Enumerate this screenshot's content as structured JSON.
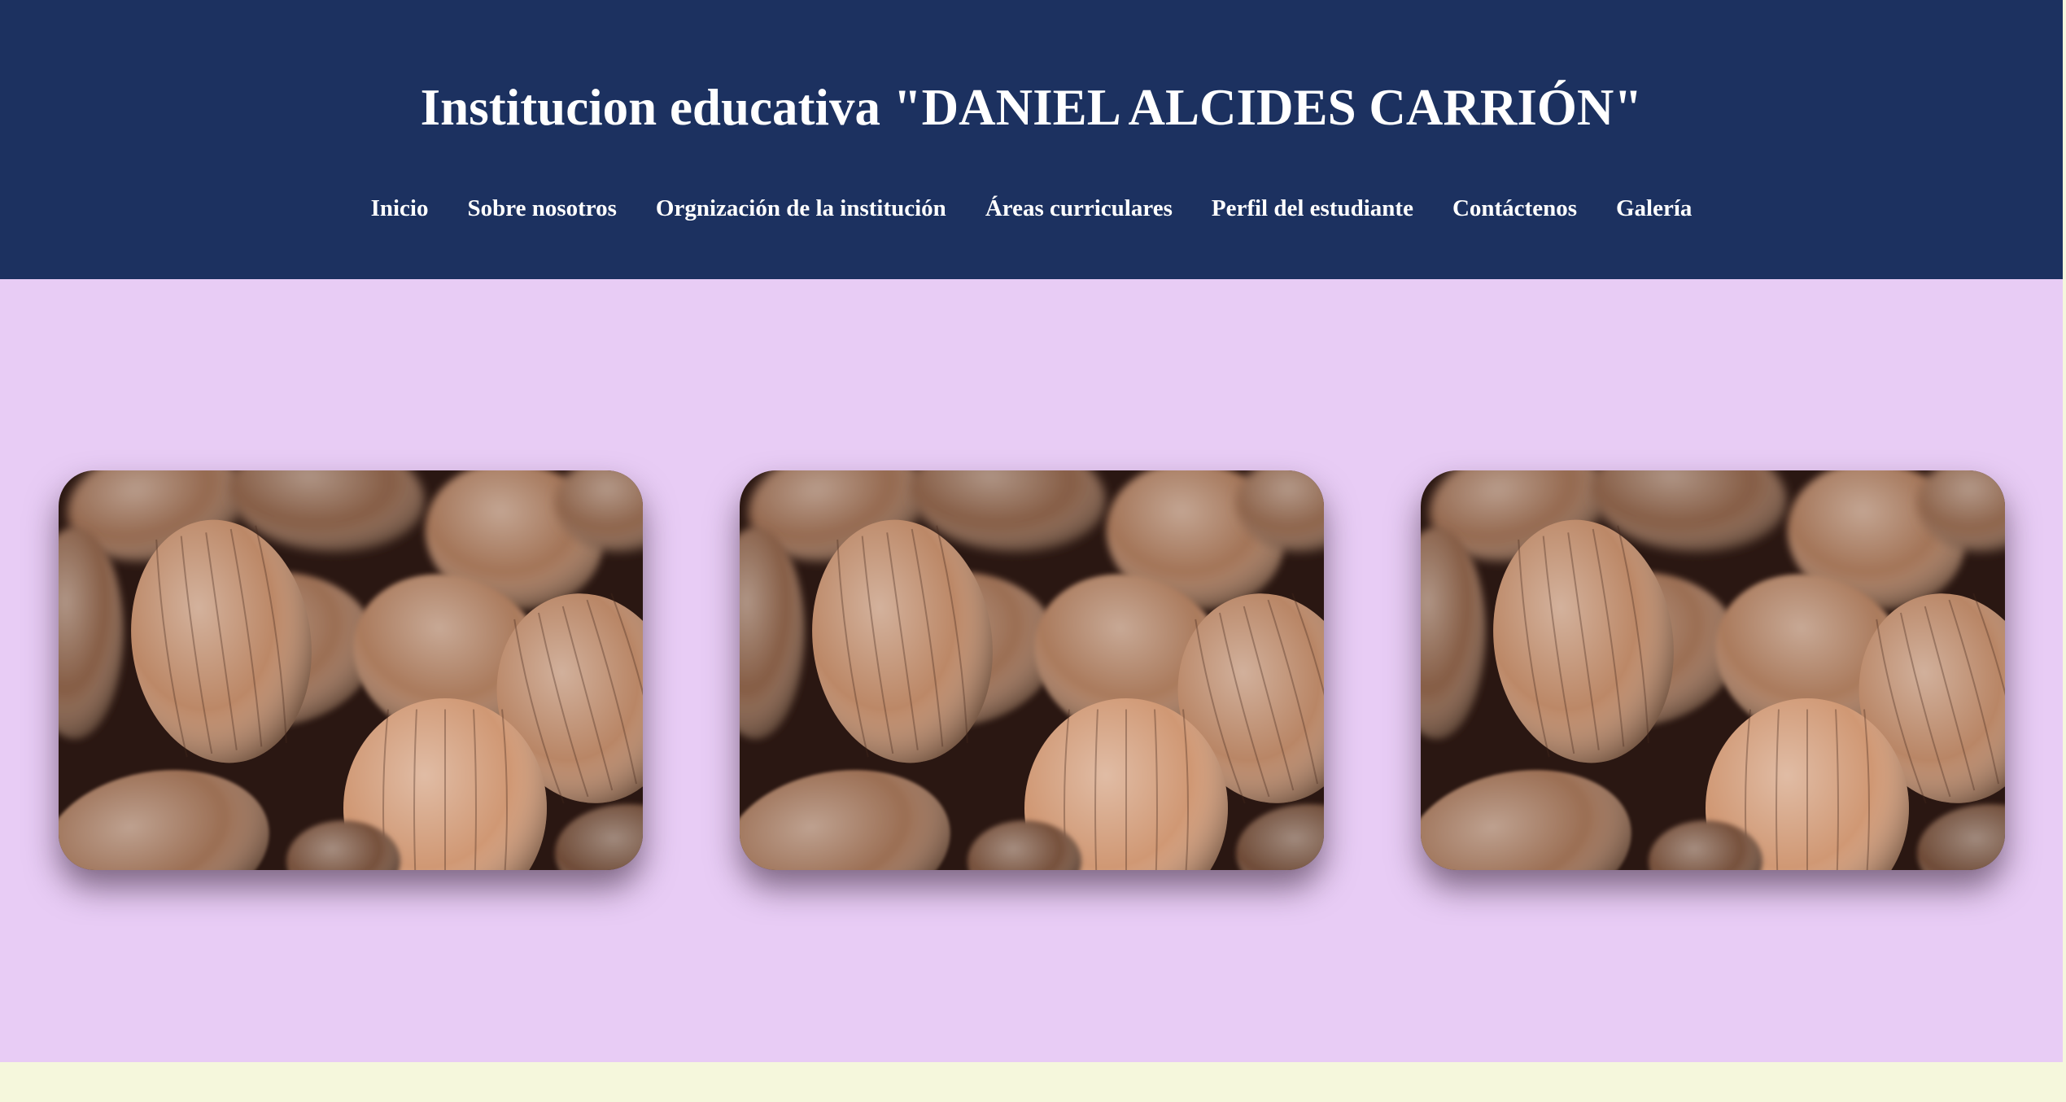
{
  "header": {
    "title": "Institucion educativa \"DANIEL ALCIDES CARRIÓN\"",
    "nav": [
      {
        "label": "Inicio"
      },
      {
        "label": "Sobre nosotros"
      },
      {
        "label": "Orgnización de la institución"
      },
      {
        "label": "Áreas curriculares"
      },
      {
        "label": "Perfil del estudiante"
      },
      {
        "label": "Contáctenos"
      },
      {
        "label": "Galería"
      }
    ]
  },
  "colors": {
    "header_bg": "#1c3160",
    "main_bg": "#e8ccf5",
    "footer_bg": "#f5f7dc",
    "text": "#ffffff"
  },
  "gallery": {
    "images": [
      {
        "subject": "walnuts-photo"
      },
      {
        "subject": "walnuts-photo"
      },
      {
        "subject": "walnuts-photo"
      }
    ]
  }
}
